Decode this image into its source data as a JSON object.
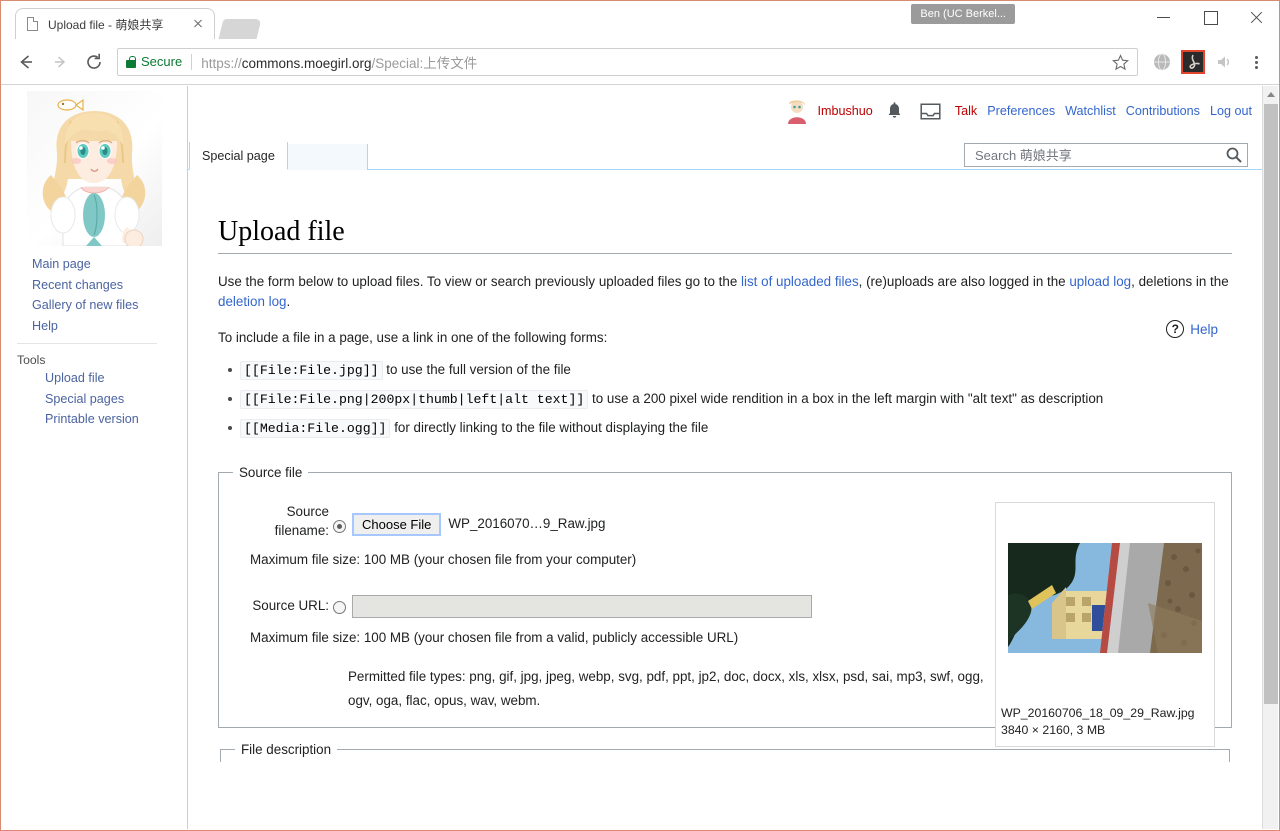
{
  "browser": {
    "tab": {
      "title": "Upload file - 萌娘共享",
      "favicon": "page-icon",
      "close": "×"
    },
    "profile_chip": "Ben (UC Berkel...",
    "window_controls": {
      "minimize": "minimize-icon",
      "maximize": "maximize-icon",
      "close": "close-icon"
    },
    "nav": {
      "back": "back-arrow-icon",
      "forward": "forward-arrow-icon",
      "reload": "reload-icon"
    },
    "omnibox": {
      "security_label": "Secure",
      "url_scheme": "https://",
      "url_host": "commons.moegirl.org",
      "url_path": "/Special:上传文件",
      "full_url": "https://commons.moegirl.org/Special:上传文件",
      "bookmark": "star-icon"
    },
    "extensions": [
      "globe-extension-icon",
      "adobe-acrobat-icon",
      "speaker-extension-icon"
    ],
    "menu": "three-dot-menu-icon"
  },
  "wiki": {
    "userbar": {
      "avatar": "user-avatar",
      "username": "Imbushuo",
      "alerts_icon": "bell-icon",
      "notices_icon": "tray-icon",
      "links": [
        {
          "label": "Talk",
          "style": "red"
        },
        {
          "label": "Preferences",
          "style": "blue"
        },
        {
          "label": "Watchlist",
          "style": "blue"
        },
        {
          "label": "Contributions",
          "style": "blue"
        },
        {
          "label": "Log out",
          "style": "blue"
        }
      ]
    },
    "namespace_tab": "Special page",
    "search": {
      "placeholder": "Search 萌娘共享",
      "value": "",
      "icon": "search-icon"
    },
    "sidebar": {
      "logo": "moegirl-mascot-logo",
      "nav_items": [
        {
          "label": "Main page"
        },
        {
          "label": "Recent changes"
        },
        {
          "label": "Gallery of new files"
        },
        {
          "label": "Help"
        }
      ],
      "tools_heading": "Tools",
      "tools_items": [
        {
          "label": "Upload file"
        },
        {
          "label": "Special pages"
        },
        {
          "label": "Printable version"
        }
      ]
    },
    "page": {
      "title": "Upload file",
      "help_label": "Help",
      "help_icon": "question-circle-icon",
      "intro": {
        "part1": "Use the form below to upload files. To view or search previously uploaded files go to the ",
        "link1": "list of uploaded files",
        "part2": ", (re)uploads are also logged in the ",
        "link2": "upload log",
        "part3": ", deletions in the ",
        "link3": "deletion log",
        "part4": "."
      },
      "include_intro": "To include a file in a page, use a link in one of the following forms:",
      "syntax_items": [
        {
          "code": "[[File:File.jpg]]",
          "desc": "to use the full version of the file"
        },
        {
          "code": "[[File:File.png|200px|thumb|left|alt text]]",
          "desc": "to use a 200 pixel wide rendition in a box in the left margin with \"alt text\" as description"
        },
        {
          "code": "[[Media:File.ogg]]",
          "desc": "for directly linking to the file without displaying the file"
        }
      ],
      "source_file": {
        "legend": "Source file",
        "filename_label": "Source filename:",
        "choose_button": "Choose File",
        "chosen_file": "WP_2016070…9_Raw.jpg",
        "max_size_local": "Maximum file size: 100 MB (your chosen file from your computer)",
        "url_label": "Source URL:",
        "url_value": "",
        "max_size_url": "Maximum file size: 100 MB (your chosen file from a valid, publicly accessible URL)",
        "permitted_types": "Permitted file types: png, gif, jpg, jpeg, webp, svg, pdf, ppt, jp2, doc, docx, xls, xlsx, psd, sai, mp3, swf, ogg, ogv, oga, flac, opus, wav, webm.",
        "source_radio_selected": true,
        "url_radio_selected": false
      },
      "preview": {
        "filename": "WP_20160706_18_09_29_Raw.jpg",
        "dimensions": "3840 × 2160, 3 MB"
      },
      "file_description_legend": "File description"
    }
  },
  "colors": {
    "link_blue": "#3366cc",
    "link_red": "#ba0000",
    "secure_green": "#0b7a35",
    "wiki_border": "#a7d7f9",
    "window_border": "#d88b72"
  }
}
